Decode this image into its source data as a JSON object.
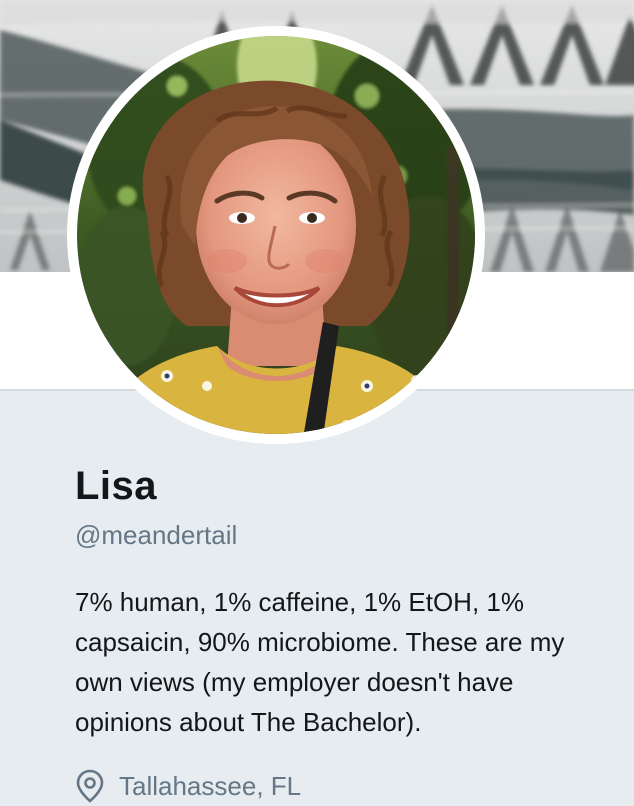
{
  "profile": {
    "name": "Lisa",
    "handle": "@meandertail",
    "bio": "7% human, 1% caffeine, 1% EtOH, 1% capsaicin, 90% microbiome. These are my own views (my employer doesn't have opinions about The Bachelor).",
    "location": "Tallahassee, FL"
  },
  "icons": {
    "location": "location-pin-icon"
  },
  "colors": {
    "page_background": "#e6ecf0",
    "name_text": "#14171a",
    "secondary_text": "#657786"
  }
}
